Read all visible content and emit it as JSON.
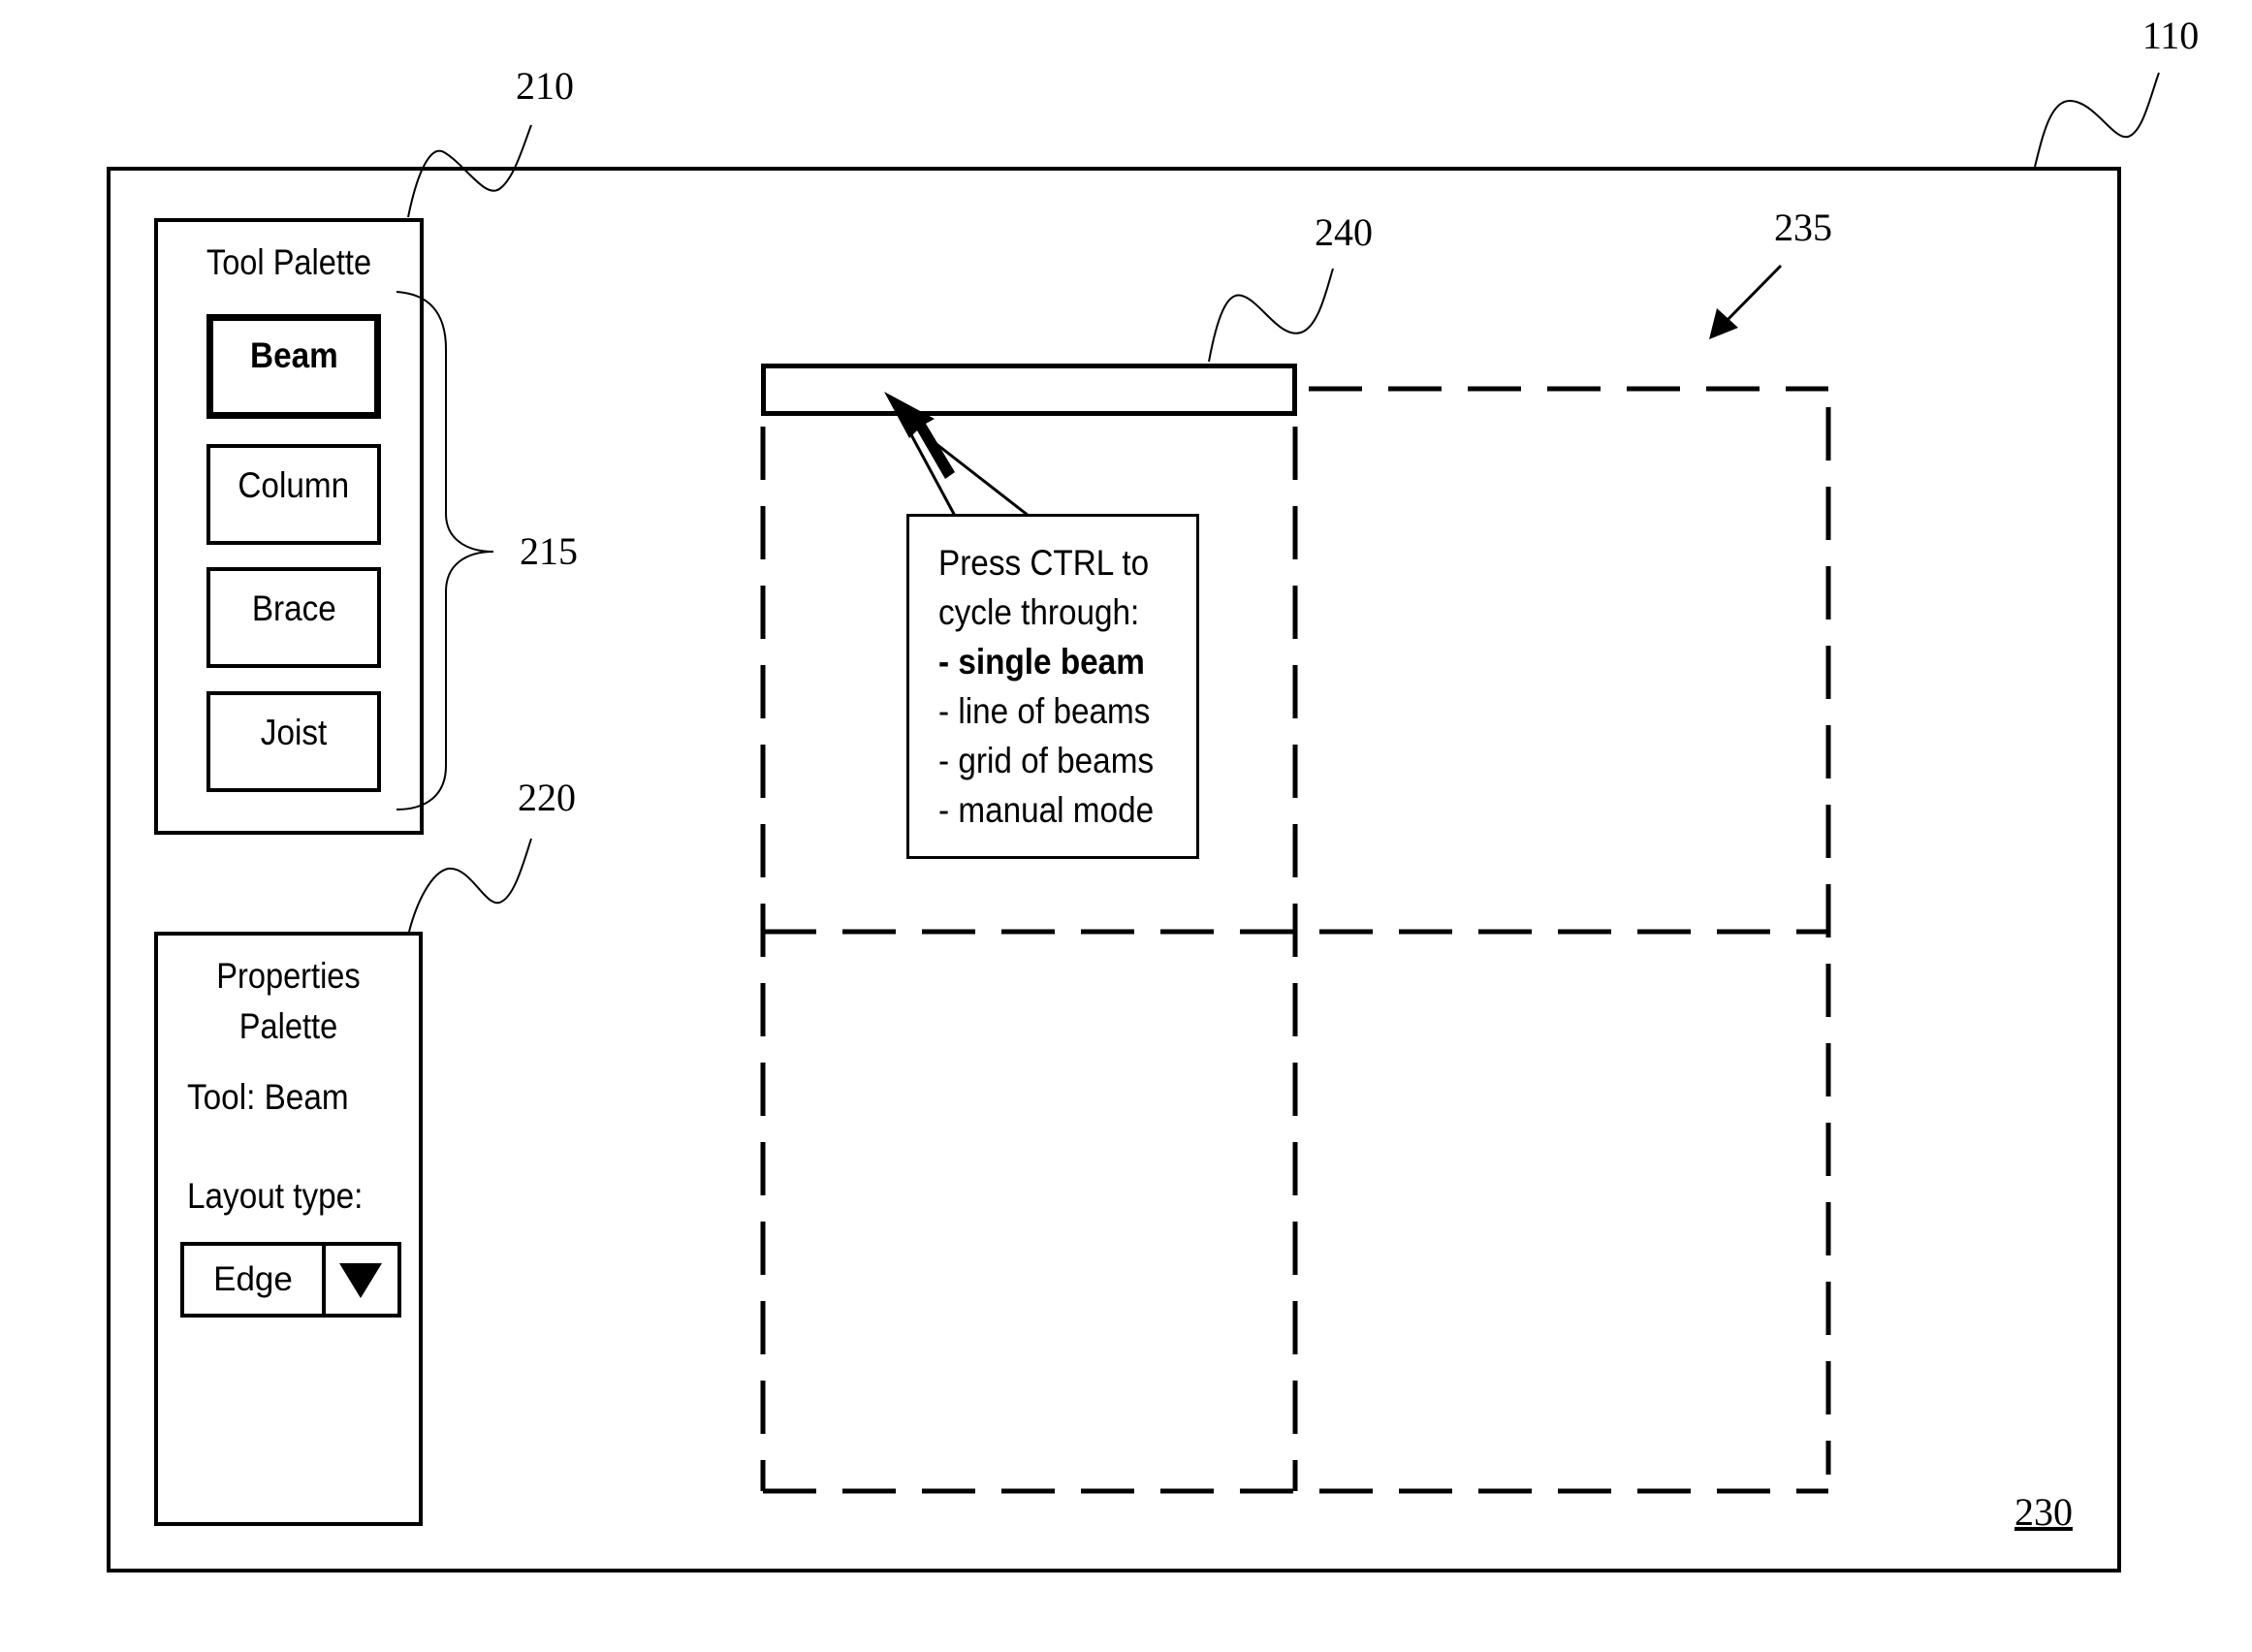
{
  "refs": {
    "window": "110",
    "tool_palette": "210",
    "tool_buttons_group": "215",
    "properties_palette": "220",
    "drawing_area": "230",
    "grid_layout": "235",
    "beam_preview": "240"
  },
  "tool_palette": {
    "title": "Tool Palette",
    "buttons": [
      {
        "label": "Beam",
        "active": true
      },
      {
        "label": "Column",
        "active": false
      },
      {
        "label": "Brace",
        "active": false
      },
      {
        "label": "Joist",
        "active": false
      }
    ]
  },
  "properties_palette": {
    "title_line1": "Properties",
    "title_line2": "Palette",
    "tool_label": "Tool: Beam",
    "layout_label": "Layout type:",
    "layout_value": "Edge",
    "dropdown_icon": "triangle-down-icon"
  },
  "tooltip": {
    "line1": "Press CTRL to",
    "line2": "cycle through:",
    "options": [
      "- single beam",
      "- line of beams",
      "- grid of beams",
      "- manual mode"
    ],
    "selected_index": 0
  }
}
